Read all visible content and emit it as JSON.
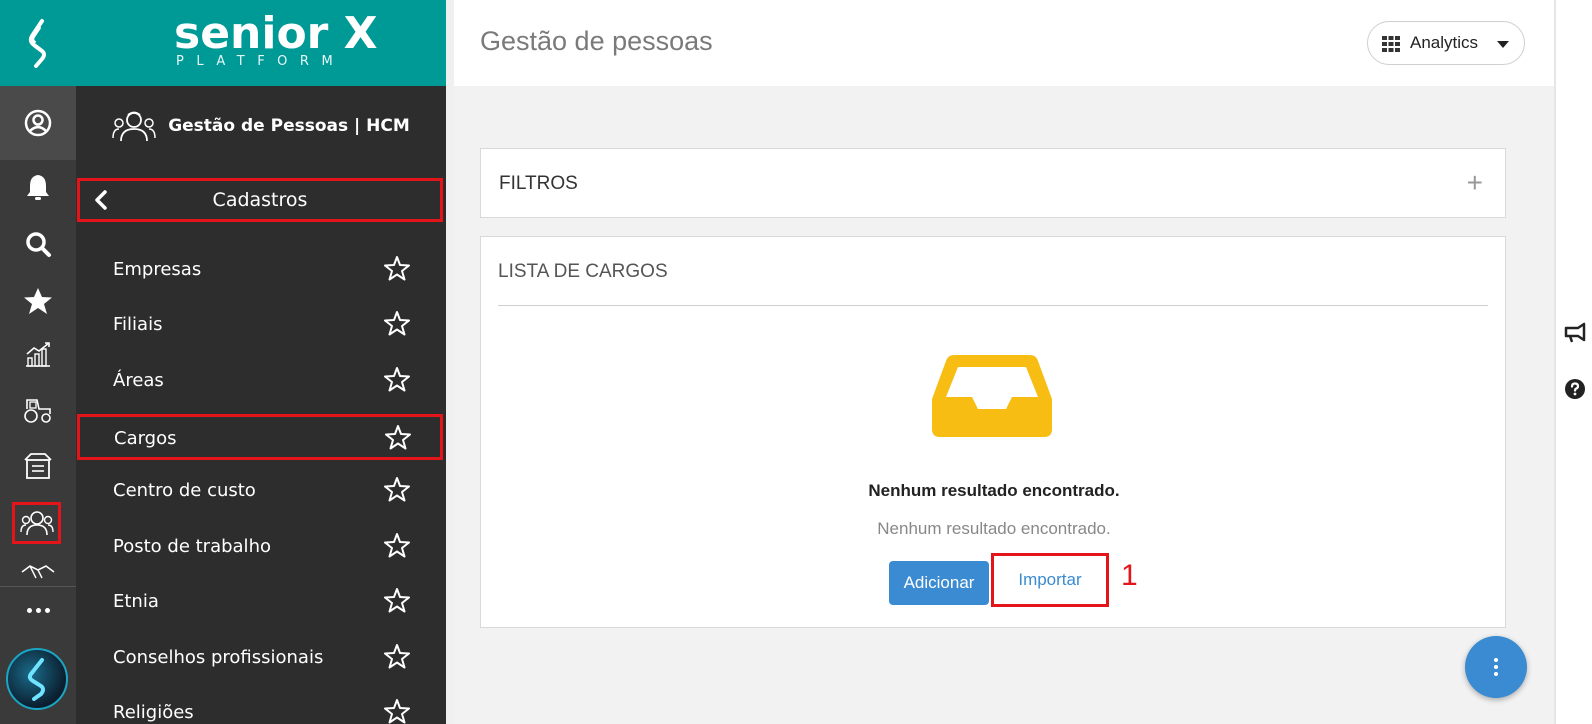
{
  "brand": {
    "name": "senior X",
    "tagline": "PLATFORM"
  },
  "module": {
    "title": "Gestão de Pessoas | HCM"
  },
  "section": {
    "title": "Cadastros"
  },
  "menu": {
    "items": [
      {
        "label": "Empresas"
      },
      {
        "label": "Filiais"
      },
      {
        "label": "Áreas"
      },
      {
        "label": "Cargos"
      },
      {
        "label": "Centro de custo"
      },
      {
        "label": "Posto de trabalho"
      },
      {
        "label": "Etnia"
      },
      {
        "label": "Conselhos profissionais"
      },
      {
        "label": "Religiões"
      }
    ],
    "selected": "Cargos"
  },
  "header": {
    "title": "Gestão de pessoas",
    "analytics_label": "Analytics"
  },
  "filters": {
    "label": "FILTROS",
    "expand_symbol": "+"
  },
  "list": {
    "label": "LISTA DE CARGOS",
    "empty_title": "Nenhum resultado encontrado.",
    "empty_subtitle": "Nenhum resultado encontrado.",
    "add_label": "Adicionar",
    "import_label": "Importar",
    "step_number": "1"
  },
  "colors": {
    "brand_teal": "#009a96",
    "sidebar_dark": "#2d2d2d",
    "rail_dark": "#3a3a3a",
    "highlight_red": "#e3151a",
    "primary_blue": "#3a8bd1",
    "empty_icon_yellow": "#f8bd13"
  },
  "icons": {
    "rail": [
      "senior-logo-icon",
      "user-circle-icon",
      "bell-icon",
      "search-icon",
      "star-icon",
      "chart-icon",
      "tractor-icon",
      "inbox-icon",
      "people-icon",
      "handshake-icon",
      "more-icon",
      "ai-assistant-icon"
    ],
    "right_strip": [
      "megaphone-icon",
      "help-icon"
    ]
  }
}
